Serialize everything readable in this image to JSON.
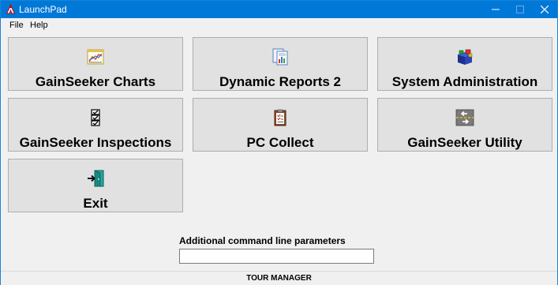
{
  "window": {
    "title": "LaunchPad"
  },
  "menu": {
    "items": [
      {
        "label": "File"
      },
      {
        "label": "Help"
      }
    ]
  },
  "tiles": [
    {
      "label": "GainSeeker Charts",
      "icon": "chart-icon"
    },
    {
      "label": "Dynamic Reports 2",
      "icon": "reports-icon"
    },
    {
      "label": "System Administration",
      "icon": "admin-blocks-icon"
    },
    {
      "label": "GainSeeker Inspections",
      "icon": "checklist-icon"
    },
    {
      "label": "PC Collect",
      "icon": "clipboard-icon"
    },
    {
      "label": "GainSeeker Utility",
      "icon": "transfer-arrows-icon"
    },
    {
      "label": "Exit",
      "icon": "exit-door-icon"
    }
  ],
  "params": {
    "label": "Additional command line parameters",
    "value": "",
    "placeholder": ""
  },
  "status": {
    "text": "TOUR MANAGER"
  },
  "colors": {
    "titlebar": "#0078d7",
    "background": "#f0f0f0",
    "tile_face": "#e1e1e1",
    "tile_border": "#adadad"
  }
}
